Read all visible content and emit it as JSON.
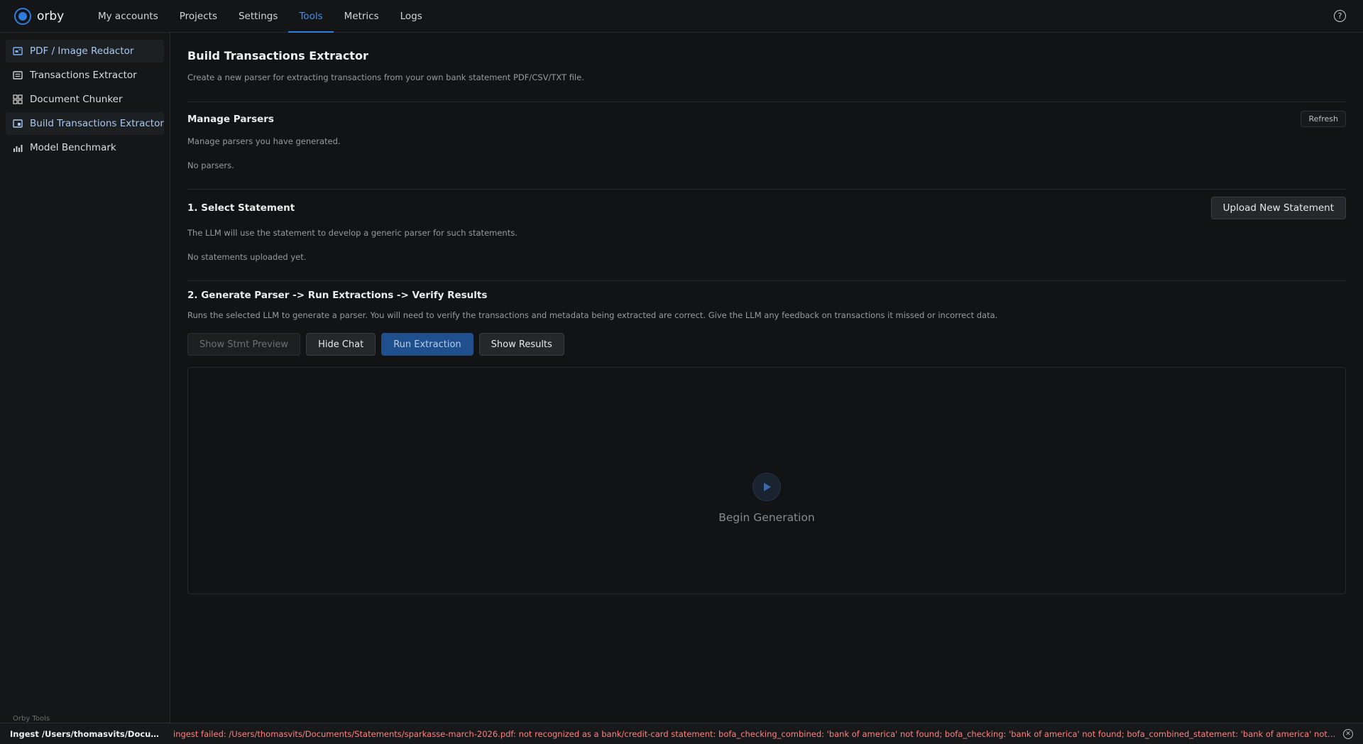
{
  "brand": {
    "name": "orby"
  },
  "nav": [
    "My accounts",
    "Projects",
    "Settings",
    "Tools",
    "Metrics",
    "Logs"
  ],
  "sidebar": {
    "items": [
      {
        "label": "PDF / Image Redactor",
        "icon": "image-icon"
      },
      {
        "label": "Transactions Extractor",
        "icon": "list-icon"
      },
      {
        "label": "Document Chunker",
        "icon": "grid-icon"
      },
      {
        "label": "Build Transactions Extractor",
        "icon": "build-icon"
      },
      {
        "label": "Model Benchmark",
        "icon": "bar-chart-icon"
      }
    ],
    "footer": "Orby Tools"
  },
  "main": {
    "title": "Build Transactions Extractor",
    "subtitle": "Create a new parser for extracting transactions from your own bank statement PDF/CSV/TXT file.",
    "manage": {
      "title": "Manage Parsers",
      "desc": "Manage parsers you have generated.",
      "empty": "No parsers.",
      "refresh": "Refresh"
    },
    "select": {
      "title": "1. Select Statement",
      "desc": "The LLM will use the statement to develop a generic parser for such statements.",
      "empty": "No statements uploaded yet.",
      "upload": "Upload New Statement"
    },
    "generate": {
      "title": "2. Generate Parser -> Run Extractions -> Verify Results",
      "desc": "Runs the selected LLM to generate a parser. You will need to verify the transactions and metadata being extracted are correct. Give the LLM any feedback on transactions it missed or incorrect data.",
      "buttons": [
        "Show Stmt Preview",
        "Hide Chat",
        "Run Extraction",
        "Show Results"
      ],
      "panel_label": "Begin Generation"
    }
  },
  "status": {
    "left": "Ingest /Users/thomasvits/Documents/Sta...",
    "message": "ingest failed: /Users/thomasvits/Documents/Statements/sparkasse-march-2026.pdf: not recognized as a bank/credit-card statement: bofa_checking_combined: 'bank of america' not found; bofa_checking: 'bank of america' not found; bofa_combined_statement: 'bank of america' not found; bofa_credit_card: 'bank of am..."
  },
  "colors": {
    "accent": "#2f7de0",
    "error": "#ff8080",
    "background": "#121314"
  }
}
